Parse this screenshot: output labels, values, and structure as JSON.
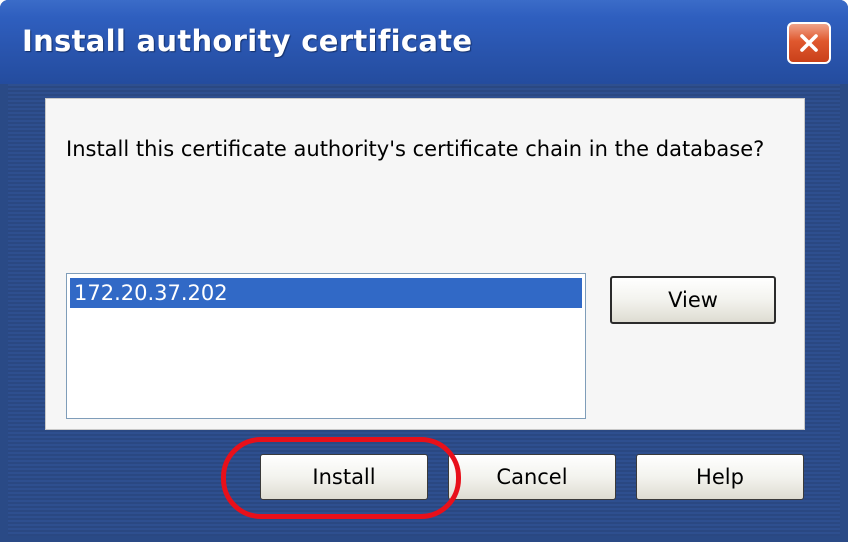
{
  "window": {
    "title": "Install authority certificate",
    "close_icon": "close-x-icon"
  },
  "dialog": {
    "prompt": "Install this certificate authority's certificate chain in the database?",
    "certificates": [
      {
        "label": "172.20.37.202",
        "selected": true
      }
    ],
    "view_label": "View"
  },
  "buttons": {
    "install_label": "Install",
    "cancel_label": "Cancel",
    "help_label": "Help"
  },
  "colors": {
    "titlebar": "#2a56b0",
    "selection": "#3169c6",
    "close_button": "#e0582e",
    "highlight_ring": "#e8101a"
  }
}
